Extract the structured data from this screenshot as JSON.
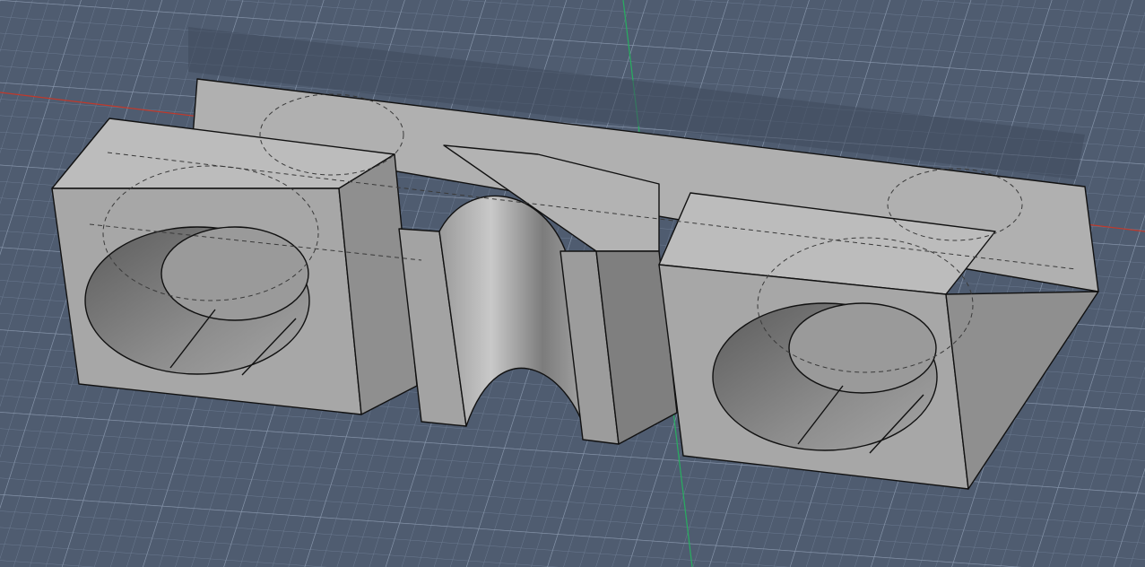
{
  "viewport": {
    "background": "#4f5c70",
    "grid_minor_color": "#6b7a90",
    "grid_major_color": "#8a98ad",
    "x_axis_color": "#c0392b",
    "y_axis_color": "#27ae60"
  },
  "model": {
    "face_color": "#a9a9a9",
    "top_face_color": "#b6b6b6",
    "side_face_color": "#8f8f8f",
    "cavity_color": "#7b7b7b",
    "edge_color": "#111111",
    "hidden_edge_color": "#3a3a3a"
  }
}
